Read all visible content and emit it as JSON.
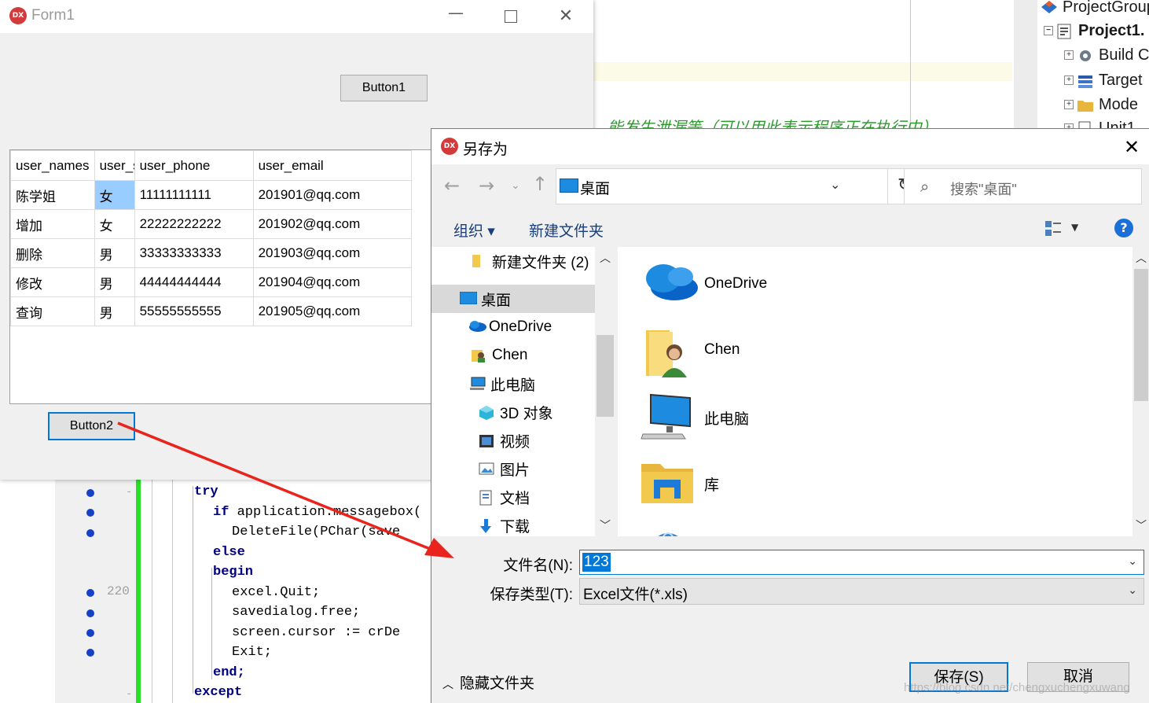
{
  "ide": {
    "comment_text": "…能发生泄漏等（可以用此表示程序正在执行中）",
    "project_tree": [
      "ProjectGroup",
      "Project1.",
      "Build C",
      "Target",
      "Mode",
      "Unit1"
    ],
    "line_number": "220",
    "code_lines": [
      {
        "pre": "",
        "kw": "try",
        "rest": ""
      },
      {
        "pre": "  ",
        "kw": "if",
        "rest": " application.messagebox("
      },
      {
        "pre": "    ",
        "kw": "",
        "rest": "DeleteFile(PChar(save"
      },
      {
        "pre": "  ",
        "kw": "else",
        "rest": ""
      },
      {
        "pre": "  ",
        "kw": "begin",
        "rest": ""
      },
      {
        "pre": "    ",
        "kw": "",
        "rest": "excel.Quit;"
      },
      {
        "pre": "    ",
        "kw": "",
        "rest": "savedialog.free;"
      },
      {
        "pre": "    ",
        "kw": "",
        "rest": "screen.cursor := crDe"
      },
      {
        "pre": "    ",
        "kw": "",
        "rest": "Exit;"
      },
      {
        "pre": "  ",
        "kw": "end;",
        "rest": ""
      },
      {
        "pre": "",
        "kw": "except",
        "rest": ""
      }
    ]
  },
  "form1": {
    "logo": "DX",
    "title": "Form1",
    "button1": "Button1",
    "button2": "Button2",
    "grid": {
      "columns": [
        "user_names",
        "user_sex",
        "user_phone",
        "user_email"
      ],
      "rows": [
        [
          "陈学姐",
          "女",
          "11111111111",
          "201901@qq.com"
        ],
        [
          "增加",
          "女",
          "22222222222",
          "201902@qq.com"
        ],
        [
          "删除",
          "男",
          "33333333333",
          "201903@qq.com"
        ],
        [
          "修改",
          "男",
          "44444444444",
          "201904@qq.com"
        ],
        [
          "查询",
          "男",
          "55555555555",
          "201905@qq.com"
        ]
      ]
    }
  },
  "dialog": {
    "logo": "DX",
    "title": "另存为",
    "address": "桌面",
    "search_placeholder": "搜索\"桌面\"",
    "organize": "组织",
    "new_folder": "新建文件夹",
    "nav_items": [
      {
        "label": "新建文件夹 (2)",
        "icon": "folder-icon"
      },
      {
        "label": "桌面",
        "icon": "desktop-icon"
      },
      {
        "label": "OneDrive",
        "icon": "onedrive-icon"
      },
      {
        "label": "Chen",
        "icon": "user-folder-icon"
      },
      {
        "label": "此电脑",
        "icon": "computer-icon"
      },
      {
        "label": "3D 对象",
        "icon": "3d-objects-icon"
      },
      {
        "label": "视频",
        "icon": "video-icon"
      },
      {
        "label": "图片",
        "icon": "pictures-icon"
      },
      {
        "label": "文档",
        "icon": "documents-icon"
      },
      {
        "label": "下载",
        "icon": "download-icon"
      }
    ],
    "files": [
      {
        "label": "OneDrive",
        "icon": "onedrive-icon"
      },
      {
        "label": "Chen",
        "icon": "user-folder-icon"
      },
      {
        "label": "此电脑",
        "icon": "computer-icon"
      },
      {
        "label": "库",
        "icon": "library-icon"
      },
      {
        "label": "网络",
        "icon": "network-icon"
      }
    ],
    "filename_label": "文件名(N):",
    "filename_value": "123",
    "filetype_label": "保存类型(T):",
    "filetype_value": "Excel文件(*.xls)",
    "hide_folders": "隐藏文件夹",
    "save_button": "保存(S)",
    "cancel_button": "取消"
  },
  "watermark": "https://blog.csdn.net/chengxuchengxuwang",
  "colors": {
    "dx_red": "#d33a3a",
    "selection_blue": "#99ccff",
    "arrow_red": "#e8241c",
    "focus_blue": "#0078d7",
    "gutter_green": "#28e028"
  }
}
